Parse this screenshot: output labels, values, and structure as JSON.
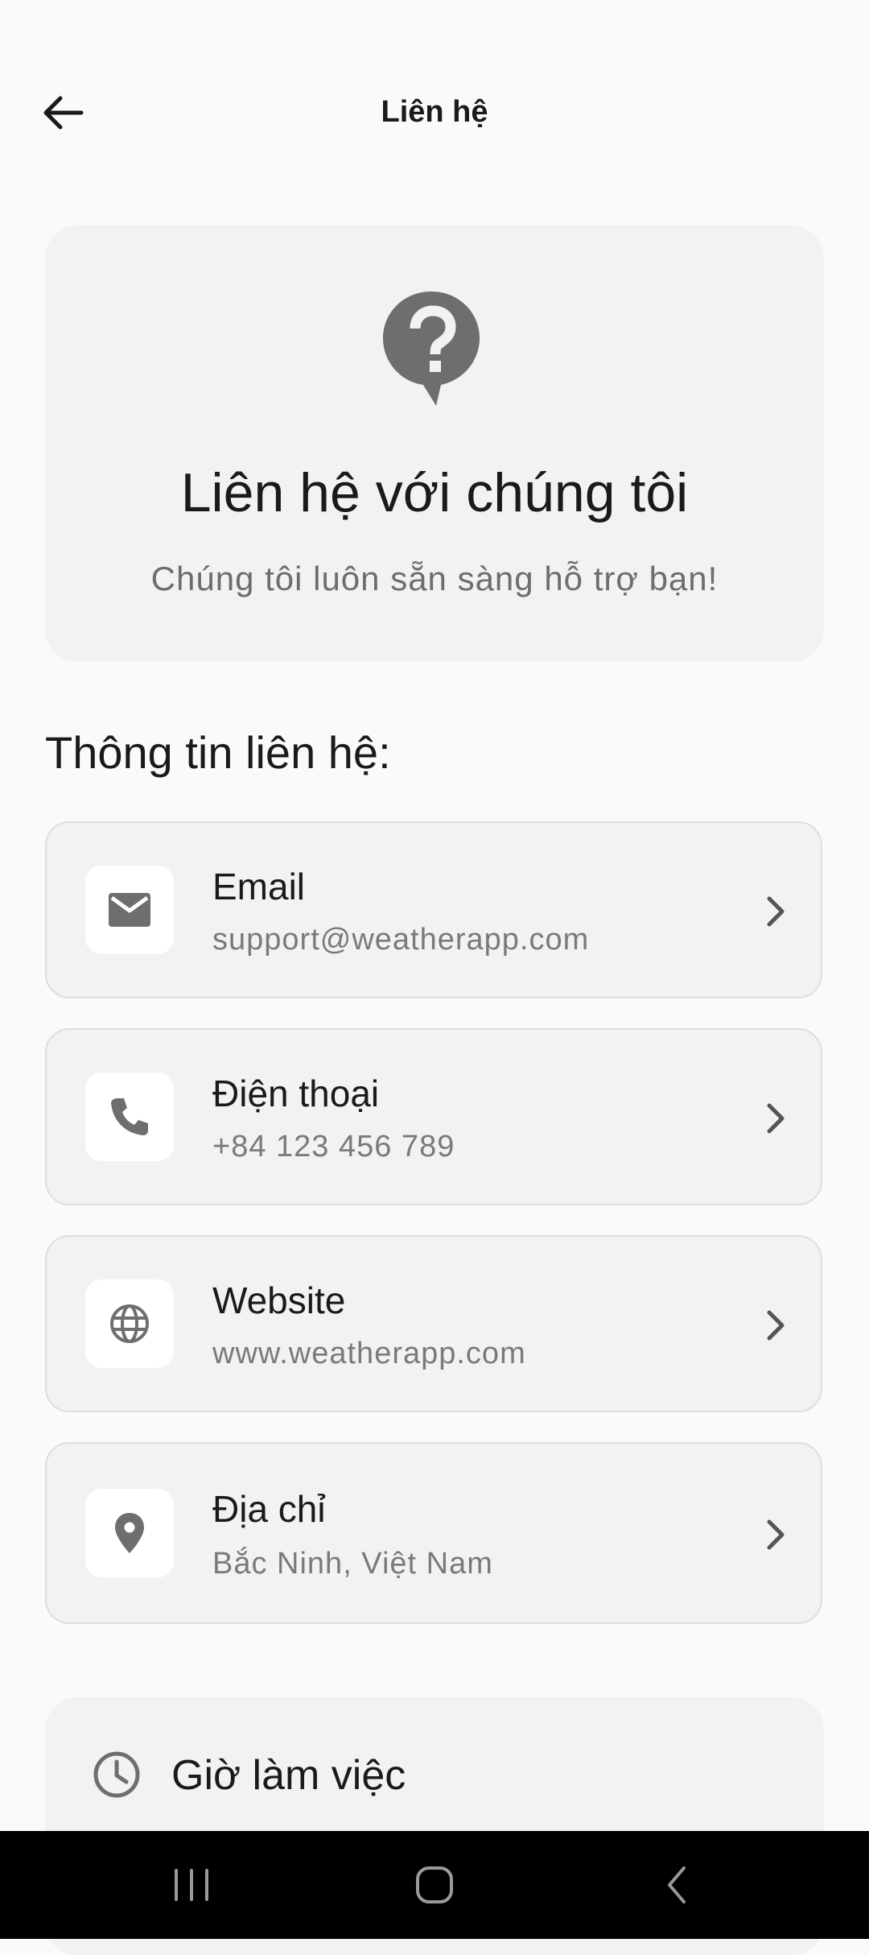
{
  "appbar": {
    "title": "Liên hệ"
  },
  "hero": {
    "title": "Liên hệ với chúng tôi",
    "subtitle": "Chúng tôi luôn sẵn sàng hỗ trợ bạn!",
    "icon": "help-bubble-icon"
  },
  "section": {
    "title": "Thông tin liên hệ:"
  },
  "contacts": [
    {
      "label": "Email",
      "value": "support@weatherapp.com",
      "icon": "mail-icon"
    },
    {
      "label": "Điện thoại",
      "value": "+84 123 456 789",
      "icon": "phone-icon"
    },
    {
      "label": "Website",
      "value": "www.weatherapp.com",
      "icon": "globe-icon"
    },
    {
      "label": "Địa chỉ",
      "value": "Bắc Ninh, Việt Nam",
      "icon": "location-pin-icon"
    }
  ],
  "hours": {
    "title": "Giờ làm việc",
    "icon": "clock-icon"
  },
  "colors": {
    "card_bg": "#f2f2f2",
    "icon_gray": "#6e6e6e",
    "text_primary": "#1a1a1a",
    "text_secondary": "#7a7a7a"
  }
}
